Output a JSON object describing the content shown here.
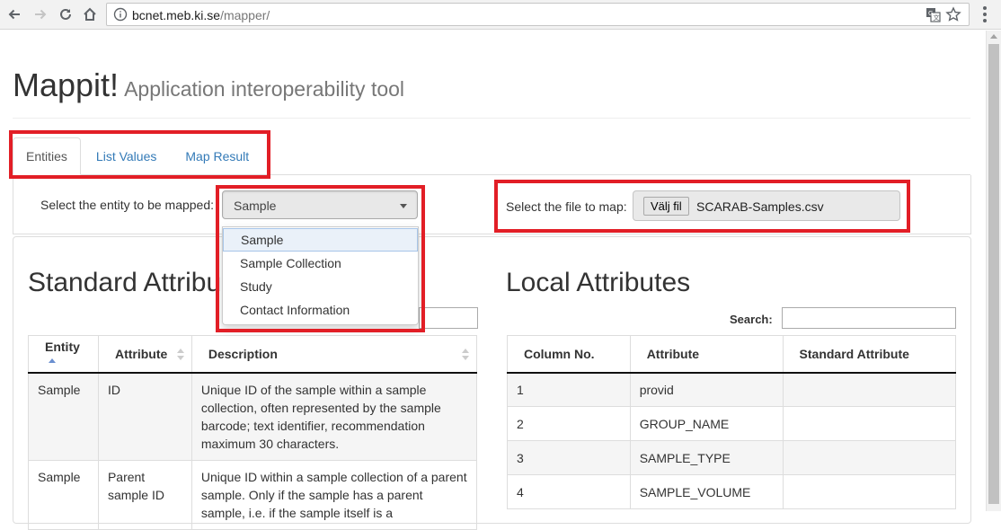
{
  "browser": {
    "url_host": "bcnet.meb.ki.se",
    "url_path": "/mapper/"
  },
  "header": {
    "title": "Mappit!",
    "subtitle": "Application interoperability tool"
  },
  "tabs": [
    {
      "label": "Entities"
    },
    {
      "label": "List Values"
    },
    {
      "label": "Map Result"
    }
  ],
  "entity_select": {
    "label": "Select the entity to be mapped:",
    "value": "Sample",
    "options": [
      "Sample",
      "Sample Collection",
      "Study",
      "Contact Information"
    ]
  },
  "file_select": {
    "label": "Select the file to map:",
    "button_label": "Välj fil",
    "file_name": "SCARAB-Samples.csv"
  },
  "standard_attributes": {
    "title": "Standard Attribu",
    "columns": [
      "Entity",
      "Attribute",
      "Description"
    ],
    "rows": [
      [
        "Sample",
        "ID",
        "Unique ID of the sample within a sample collection, often represented by the sample barcode; text identifier, recommendation maximum 30 characters."
      ],
      [
        "Sample",
        "Parent sample ID",
        "Unique ID within a sample collection of a parent sample. Only if the sample has a parent sample, i.e. if the sample itself is a"
      ]
    ]
  },
  "local_attributes": {
    "title": "Local Attributes",
    "search_label": "Search:",
    "columns": [
      "Column No.",
      "Attribute",
      "Standard Attribute"
    ],
    "rows": [
      [
        "1",
        "provid",
        ""
      ],
      [
        "2",
        "GROUP_NAME",
        ""
      ],
      [
        "3",
        "SAMPLE_TYPE",
        ""
      ],
      [
        "4",
        "SAMPLE_VOLUME",
        ""
      ]
    ]
  },
  "colors": {
    "highlight": "#e21e26",
    "link": "#337ab7"
  }
}
